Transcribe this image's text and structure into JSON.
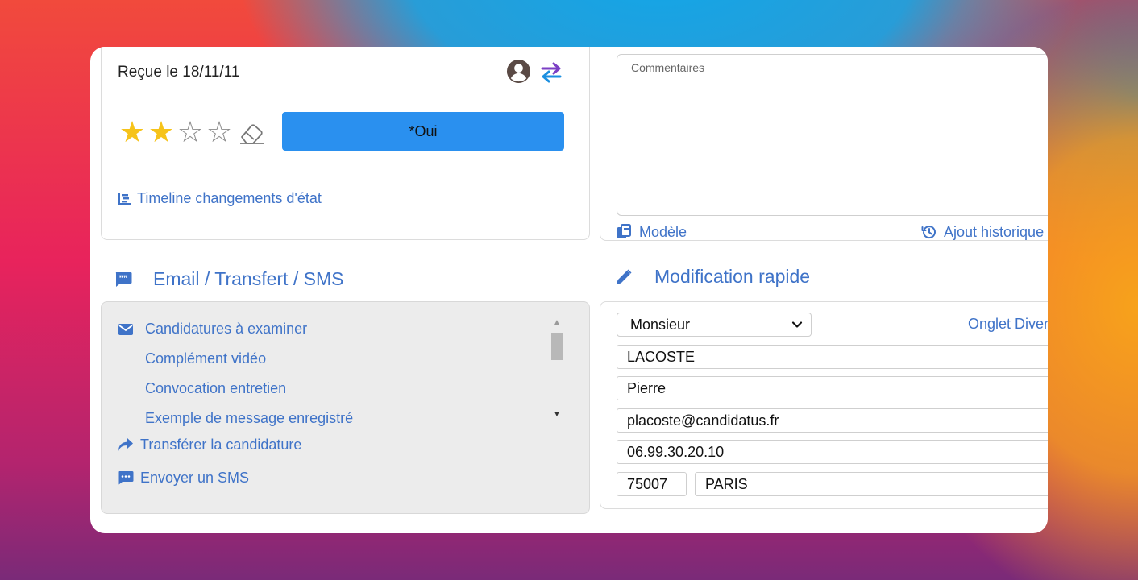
{
  "candidate_card": {
    "received_label": "Reçue le 18/11/11",
    "rating": {
      "value": 2,
      "max": 5
    },
    "status_button_label": "*Oui",
    "timeline_link": "Timeline changements d'état"
  },
  "comments": {
    "placeholder": "Commentaires",
    "model_link": "Modèle",
    "history_link": "Ajout historique"
  },
  "email_section": {
    "title": "Email / Transfert / SMS",
    "templates": [
      "Candidatures à examiner",
      "Complément vidéo",
      "Convocation entretien",
      "Exemple de message enregistré"
    ],
    "transfer_link": "Transférer la candidature",
    "sms_link": "Envoyer un SMS"
  },
  "quick_edit": {
    "title": "Modification rapide",
    "civility": "Monsieur",
    "tab_link": "Onglet Divers",
    "last_name": "LACOSTE",
    "first_name": "Pierre",
    "email": "placoste@candidatus.fr",
    "phone": "06.99.30.20.10",
    "zip": "75007",
    "city": "PARIS"
  },
  "colors": {
    "accent_blue": "#3f73c8",
    "button_blue": "#2a90ef",
    "star_gold": "#f6c31a",
    "swap_purple": "#7b3fc4"
  }
}
